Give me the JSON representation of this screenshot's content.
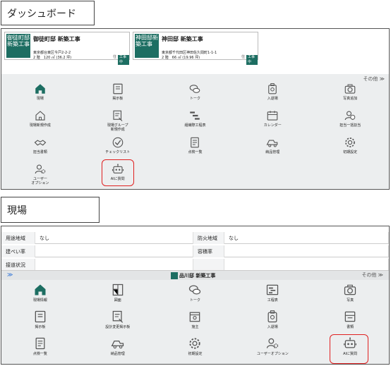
{
  "dashboard": {
    "caption": "ダッシュボード",
    "cards": [
      {
        "thumb": "御徒町邸新築工事",
        "title": "御徒町邸 新築工事",
        "address": "東京都台東区今戸2-2-2",
        "area": "2 階　120 ㎡ (36.2 坪)",
        "tag1": "住",
        "tag2": "工事中"
      },
      {
        "thumb": "神田邸新築工事",
        "title": "神田邸 新築工事",
        "address": "東京都千代田区神田佐久間町1-1-1",
        "area": "2 階　66 ㎡ (19.96 坪)",
        "tag1": "住",
        "tag2": "工事中"
      }
    ],
    "sonota": "その他 ≫",
    "menu": [
      {
        "label": "現場",
        "icon": "home-icon"
      },
      {
        "label": "掲示板",
        "icon": "board-icon"
      },
      {
        "label": "トーク",
        "icon": "chat-icon"
      },
      {
        "label": "入退場",
        "icon": "entry-icon"
      },
      {
        "label": "写真追加",
        "icon": "camera-icon"
      },
      {
        "label": "現場新規作成",
        "icon": "new-site-icon"
      },
      {
        "label": "現場グループ\n新規作成",
        "icon": "new-board-icon"
      },
      {
        "label": "組織際工程表",
        "icon": "gantt-icon"
      },
      {
        "label": "カレンダー",
        "icon": "calendar-icon"
      },
      {
        "label": "担当一括割当",
        "icon": "assign-icon"
      },
      {
        "label": "担当書類",
        "icon": "handshake-icon"
      },
      {
        "label": "チェックリスト",
        "icon": "check-icon"
      },
      {
        "label": "点検一覧",
        "icon": "inspection-icon"
      },
      {
        "label": "納品管理",
        "icon": "truck-icon"
      },
      {
        "label": "初期設定",
        "icon": "gear-icon"
      },
      {
        "label": "ユーザー\nオプション",
        "icon": "user-option-icon"
      },
      {
        "label": "AIに質問",
        "icon": "robot-icon"
      }
    ]
  },
  "genba": {
    "caption": "現場",
    "table": [
      {
        "k1": "用途地域",
        "v1": "なし",
        "k2": "防火地域",
        "v2": "なし"
      },
      {
        "k1": "建ぺい率",
        "v1": "",
        "k2": "容積率",
        "v2": ""
      },
      {
        "k1": "接道状況",
        "v1": "",
        "k2": "",
        "v2": ""
      }
    ],
    "bar_title": "品川邸 新築工事",
    "sonota": "その他 ≫",
    "menu": [
      {
        "label": "現場情報",
        "icon": "home-icon"
      },
      {
        "label": "図面",
        "icon": "drawing-icon"
      },
      {
        "label": "トーク",
        "icon": "chat-icon"
      },
      {
        "label": "工程表",
        "icon": "schedule-icon"
      },
      {
        "label": "写真",
        "icon": "camera-icon"
      },
      {
        "label": "掲示板",
        "icon": "board-icon"
      },
      {
        "label": "設計変更掲示板",
        "icon": "new-board-icon"
      },
      {
        "label": "施主",
        "icon": "owner-icon"
      },
      {
        "label": "入退場",
        "icon": "entry-icon"
      },
      {
        "label": "書類",
        "icon": "document-icon"
      },
      {
        "label": "点検一覧",
        "icon": "inspection-icon"
      },
      {
        "label": "納品管理",
        "icon": "truck-icon"
      },
      {
        "label": "初期設定",
        "icon": "gear-icon"
      },
      {
        "label": "ユーザーオプション",
        "icon": "user-option-icon"
      },
      {
        "label": "AIに質問",
        "icon": "robot-icon"
      }
    ]
  },
  "colors": {
    "accent": "#1d6e62",
    "highlight": "#e02020",
    "link": "#2a6fd6"
  }
}
